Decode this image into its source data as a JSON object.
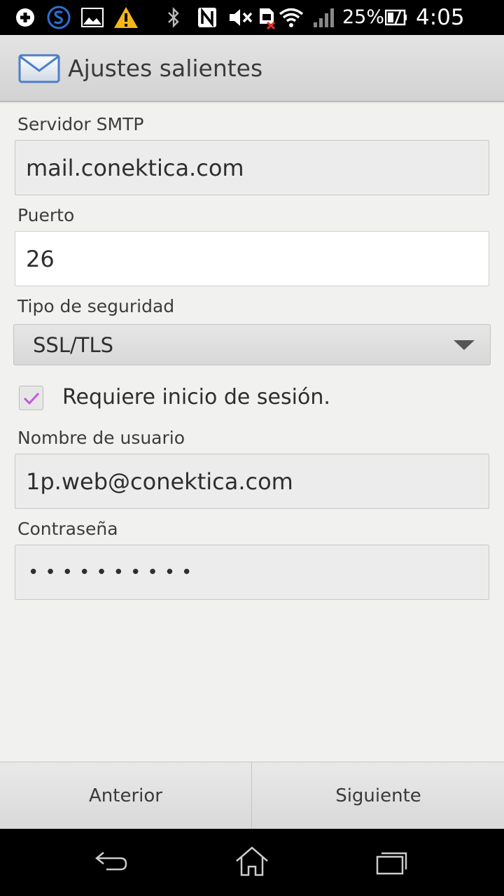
{
  "status_bar": {
    "icons": [
      "plus-icon",
      "sync-s-icon",
      "image-icon",
      "warning-icon",
      "bluetooth-icon",
      "nfc-icon",
      "mute-icon",
      "no-sim-icon",
      "wifi-icon",
      "signal-icon",
      "battery-charging-icon"
    ],
    "battery": "25%",
    "time": "4:05 pm"
  },
  "action_bar": {
    "icon": "envelope-icon",
    "title": "Ajustes salientes"
  },
  "form": {
    "smtp_label": "Servidor SMTP",
    "smtp_value": "mail.conektica.com",
    "port_label": "Puerto",
    "port_value": "26",
    "security_label": "Tipo de seguridad",
    "security_value": "SSL/TLS",
    "require_login_label": "Requiere inicio de sesión.",
    "require_login_checked": true,
    "username_label": "Nombre de usuario",
    "username_value": "1p.web@conektica.com",
    "password_label": "Contraseña",
    "password_mask": "••••••••••"
  },
  "buttons": {
    "previous": "Anterior",
    "next": "Siguiente"
  },
  "nav_bar": {
    "icons": [
      "back-icon",
      "home-icon",
      "recent-apps-icon"
    ]
  },
  "colors": {
    "check_accent": "#c455e0",
    "warning": "#f3b71a",
    "sync_blue": "#2d6fd1"
  }
}
